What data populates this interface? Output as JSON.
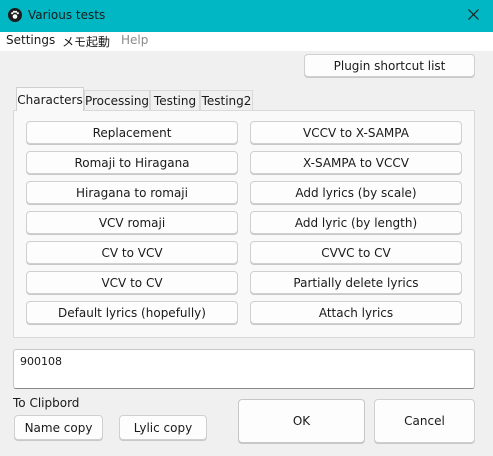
{
  "window": {
    "title": "Various tests",
    "app_icon": "paw-icon",
    "accent": "#00b7c3"
  },
  "menu": {
    "settings": "Settings",
    "memo": "メモ起動",
    "help": "Help"
  },
  "plugin_button": "Plugin shortcut list",
  "tabs": [
    "Characters",
    "Processing",
    "Testing",
    "Testing2"
  ],
  "active_tab": "Characters",
  "left_buttons": [
    "Replacement",
    "Romaji to Hiragana",
    "Hiragana to romaji",
    "VCV romaji",
    "CV to VCV",
    "VCV to CV",
    "Default lyrics (hopefully)"
  ],
  "right_buttons": [
    "VCCV to X-SAMPA",
    "X-SAMPA to VCCV",
    "Add lyrics (by scale)",
    "Add lyric (by length)",
    "CVVC to CV",
    "Partially delete lyrics",
    "Attach lyrics"
  ],
  "text_value": "900108",
  "clipboard": {
    "label": "To Clipbord",
    "name_copy": "Name copy",
    "lyric_copy": "Lylic copy"
  },
  "ok": "OK",
  "cancel": "Cancel"
}
